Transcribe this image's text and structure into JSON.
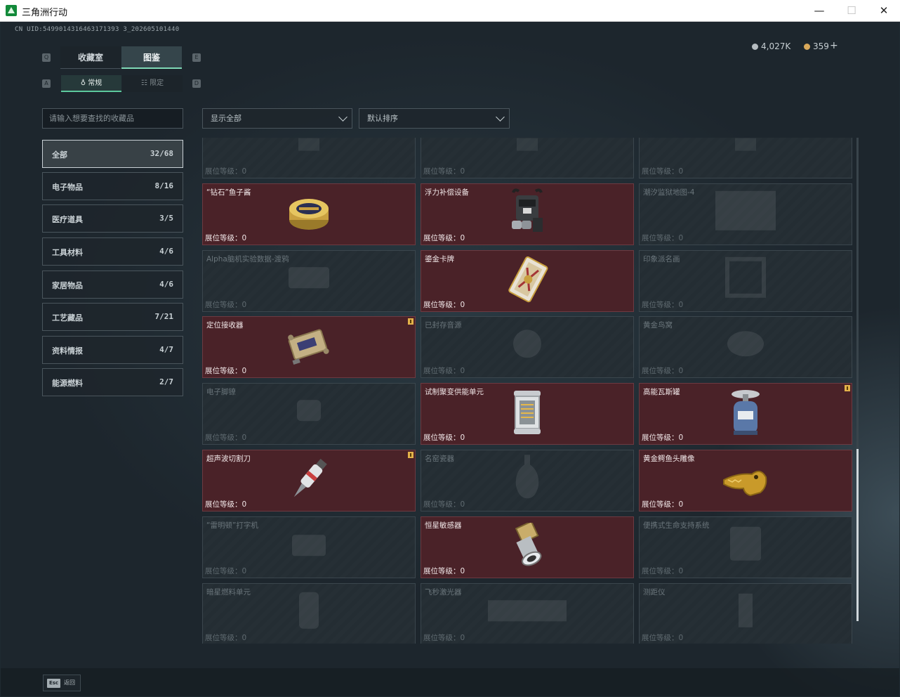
{
  "window": {
    "title": "三角洲行动",
    "minimize": "—",
    "maximize": "☐",
    "close": "✕"
  },
  "uid": "CN UID:5499014316463171393 3_202605101440",
  "currency": {
    "coins": "4,027K",
    "gems": "359",
    "plus": "+"
  },
  "tabs": {
    "collection": "收藏室",
    "gallery": "图鉴",
    "left_key": "Q",
    "right_key": "E"
  },
  "subtabs": {
    "normal": "常规",
    "limited": "限定",
    "left_key": "A",
    "right_key": "D"
  },
  "search_placeholder": "请输入想要查找的收藏品",
  "filter": "显示全部",
  "sort": "默认排序",
  "categories": [
    {
      "name": "全部",
      "count": "32/68"
    },
    {
      "name": "电子物品",
      "count": "8/16"
    },
    {
      "name": "医疗道具",
      "count": "3/5"
    },
    {
      "name": "工具材料",
      "count": "4/6"
    },
    {
      "name": "家居物品",
      "count": "4/6"
    },
    {
      "name": "工艺藏品",
      "count": "7/21"
    },
    {
      "name": "资料情报",
      "count": "4/7"
    },
    {
      "name": "能源燃料",
      "count": "2/7"
    }
  ],
  "level_label": "展位等级：0",
  "items": [
    {
      "name": "",
      "owned": false,
      "badge": false,
      "icon": "partial-item-icon"
    },
    {
      "name": "",
      "owned": false,
      "badge": false,
      "icon": "partial-item-icon"
    },
    {
      "name": "",
      "owned": false,
      "badge": false,
      "icon": "partial-item-icon"
    },
    {
      "name": "“钻石”鱼子酱",
      "owned": true,
      "badge": false,
      "icon": "caviar-tin-icon"
    },
    {
      "name": "浮力补偿设备",
      "owned": true,
      "badge": false,
      "icon": "buoyancy-device-icon"
    },
    {
      "name": "潮汐监狱地图-4",
      "owned": false,
      "badge": false,
      "icon": "map-icon"
    },
    {
      "name": "Alpha脑机实验数据-渡鸦",
      "owned": false,
      "badge": false,
      "icon": "data-drive-icon"
    },
    {
      "name": "鎏金卡牌",
      "owned": true,
      "badge": false,
      "icon": "gold-card-icon"
    },
    {
      "name": "印象派名画",
      "owned": false,
      "badge": false,
      "icon": "painting-icon"
    },
    {
      "name": "定位接收器",
      "owned": true,
      "badge": true,
      "icon": "locator-receiver-icon"
    },
    {
      "name": "已封存音源",
      "owned": false,
      "badge": false,
      "icon": "audio-source-icon"
    },
    {
      "name": "黄金鸟窝",
      "owned": false,
      "badge": false,
      "icon": "golden-nest-icon"
    },
    {
      "name": "电子脚镣",
      "owned": false,
      "badge": false,
      "icon": "ankle-monitor-icon"
    },
    {
      "name": "试制聚变供能单元",
      "owned": true,
      "badge": false,
      "icon": "fusion-cell-icon"
    },
    {
      "name": "高能瓦斯罐",
      "owned": true,
      "badge": true,
      "icon": "gas-canister-icon"
    },
    {
      "name": "超声波切割刀",
      "owned": true,
      "badge": true,
      "icon": "ultrasonic-cutter-icon"
    },
    {
      "name": "名窑瓷器",
      "owned": false,
      "badge": false,
      "icon": "porcelain-vase-icon"
    },
    {
      "name": "黄金鳄鱼头雕像",
      "owned": true,
      "badge": false,
      "icon": "gold-crocodile-icon"
    },
    {
      "name": "“雷明顿”打字机",
      "owned": false,
      "badge": false,
      "icon": "typewriter-icon"
    },
    {
      "name": "恒星敏感器",
      "owned": true,
      "badge": false,
      "icon": "star-sensor-icon"
    },
    {
      "name": "便携式生命支持系统",
      "owned": false,
      "badge": false,
      "icon": "life-support-icon"
    },
    {
      "name": "暗星燃料单元",
      "owned": false,
      "badge": false,
      "icon": "fuel-cell-icon"
    },
    {
      "name": "飞秒激光器",
      "owned": false,
      "badge": false,
      "icon": "laser-device-icon"
    },
    {
      "name": "测距仪",
      "owned": false,
      "badge": false,
      "icon": "rangefinder-icon"
    }
  ],
  "esc": {
    "key": "Esc",
    "label": "返回"
  }
}
